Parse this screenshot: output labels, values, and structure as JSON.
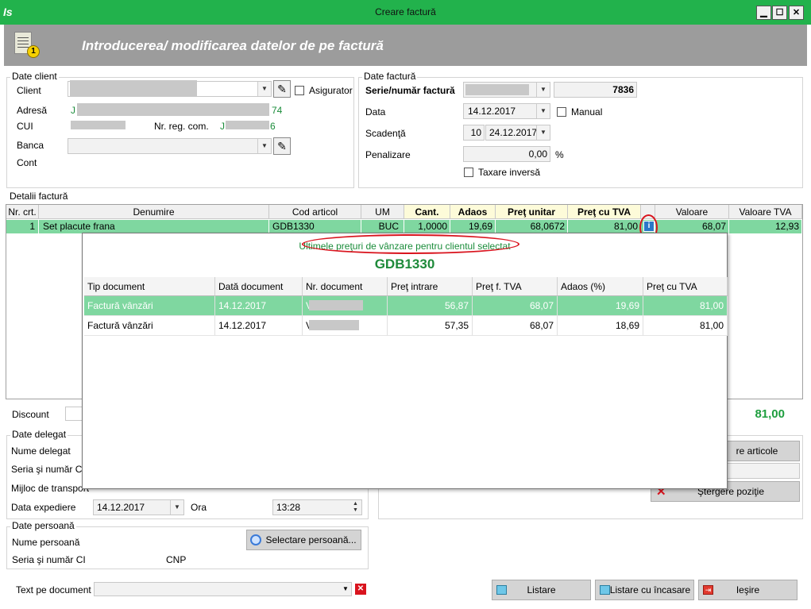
{
  "window": {
    "title": "Creare factură",
    "app_icon": "app-logo-icon"
  },
  "banner": {
    "title": "Introducerea/ modificarea datelor de pe factură",
    "badge": "1"
  },
  "client": {
    "group": "Date client",
    "client_label": "Client",
    "asigurator_label": "Asigurator",
    "adresa_label": "Adresă",
    "adresa_prefix": "J",
    "adresa_suffix": "74",
    "cui_label": "CUI",
    "nrreg_label": "Nr. reg. com.",
    "nrreg_prefix": "J",
    "nrreg_suffix": "6",
    "banca_label": "Banca",
    "cont_label": "Cont"
  },
  "invoice": {
    "group": "Date factură",
    "serie_label": "Serie/număr factură",
    "number": "7836",
    "data_label": "Data",
    "data_value": "14.12.2017",
    "manual_label": "Manual",
    "scadenta_label": "Scadenţă",
    "scadenta_days": "10",
    "scadenta_date": "24.12.2017",
    "penalizare_label": "Penalizare",
    "penalizare_value": "0,00",
    "penalizare_unit": "%",
    "taxare_label": "Taxare inversă"
  },
  "details": {
    "group": "Detalii factură",
    "columns": [
      "Nr. crt.",
      "Denumire",
      "Cod articol",
      "UM",
      "Cant.",
      "Adaos",
      "Preţ unitar",
      "Preţ cu TVA",
      "",
      "Valoare",
      "Valoare TVA"
    ],
    "row": [
      "1",
      "Set placute frana",
      "GDB1330",
      "BUC",
      "1,0000",
      "19,69",
      "68,0672",
      "81,00",
      "",
      "68,07",
      "12,93"
    ],
    "discount_label": "Discount",
    "total": "81,00"
  },
  "popup": {
    "caption": "Ultimele preţuri de vânzare pentru clientul selectat",
    "code": "GDB1330",
    "columns": [
      "Tip document",
      "Dată document",
      "Nr. document",
      "Preţ intrare",
      "Preţ f. TVA",
      "Adaos (%)",
      "Preţ cu TVA"
    ],
    "rows": [
      [
        "Factură vânzări",
        "14.12.2017",
        "V",
        "56,87",
        "68,07",
        "19,69",
        "81,00"
      ],
      [
        "Factură vânzări",
        "14.12.2017",
        "V",
        "57,35",
        "68,07",
        "18,69",
        "81,00"
      ]
    ]
  },
  "delegate": {
    "group": "Date delegat",
    "nume_label": "Nume delegat",
    "seria_label": "Seria şi număr CI",
    "mijloc_label": "Mijloc de transport",
    "expediere_label": "Data expediere",
    "expediere_value": "14.12.2017",
    "ora_label": "Ora",
    "ora_value": "13:28"
  },
  "actions": {
    "adaugare_label": "re articole",
    "stergere_label": "Ştergere poziţie"
  },
  "person": {
    "group": "Date persoană",
    "nume_label": "Nume persoană",
    "seria_label": "Seria şi număr CI",
    "cnp_label": "CNP",
    "select_label": "Selectare persoană..."
  },
  "footer": {
    "text_label": "Text pe document",
    "listare_label": "Listare",
    "listare_inc_label": "Listare cu încasare",
    "iesire_label": "Ieşire"
  },
  "colors": {
    "title_green": "#22b24c",
    "row_green": "#7fd7a0",
    "total_green": "#1e9e3e",
    "highlight_red": "#d9141e"
  }
}
